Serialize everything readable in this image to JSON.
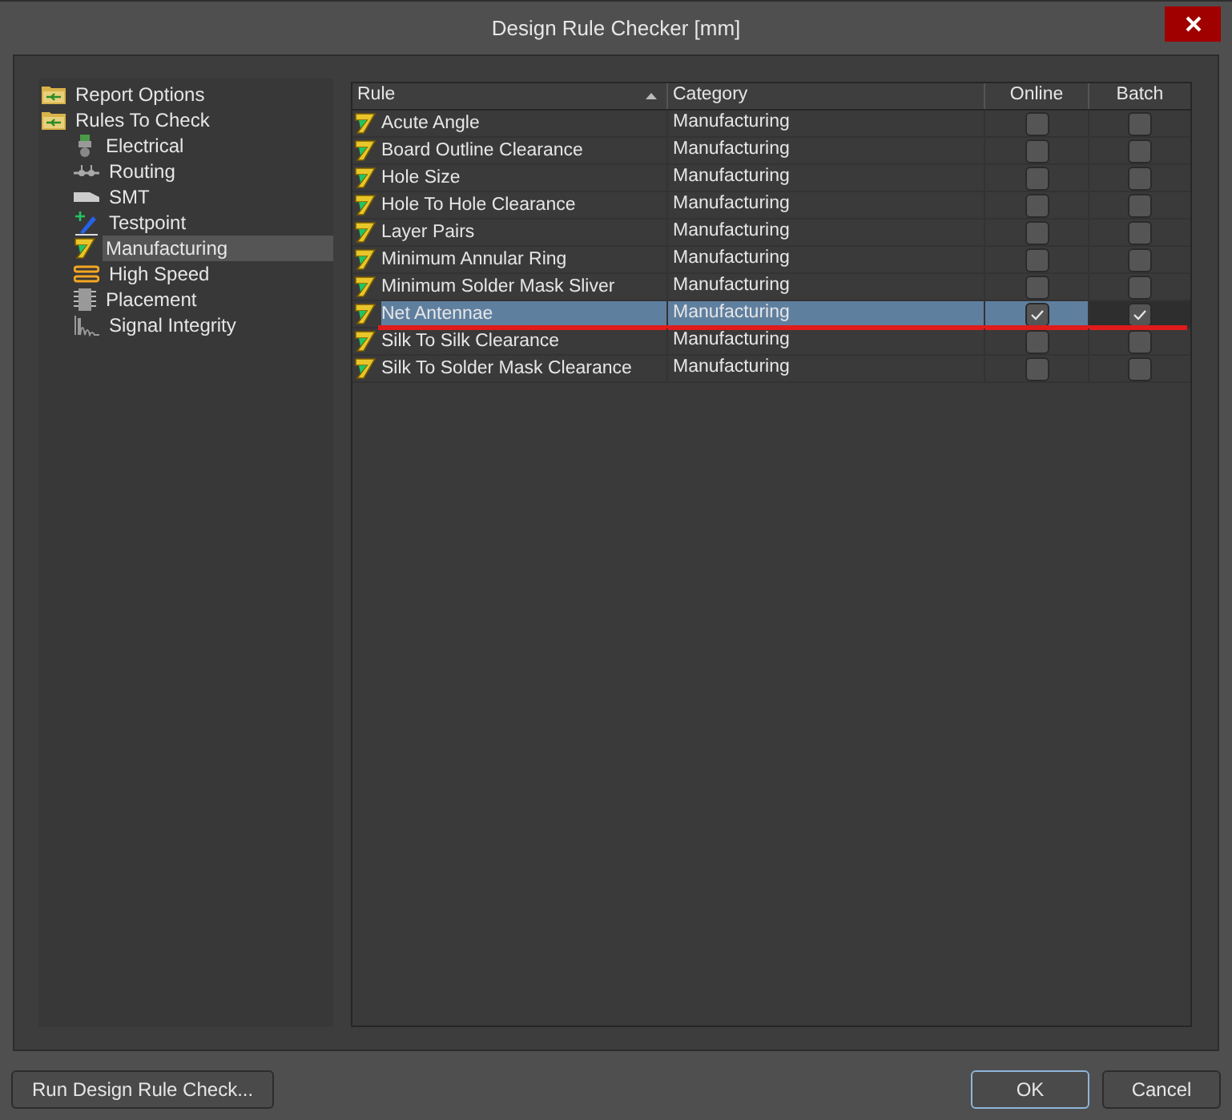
{
  "window": {
    "title": "Design Rule Checker [mm]"
  },
  "tree": [
    {
      "label": "Report Options",
      "kind": "folder",
      "selected": false
    },
    {
      "label": "Rules To Check",
      "kind": "folder",
      "selected": false,
      "children": [
        {
          "label": "Electrical",
          "kind": "electrical",
          "selected": false
        },
        {
          "label": "Routing",
          "kind": "routing",
          "selected": false
        },
        {
          "label": "SMT",
          "kind": "smt",
          "selected": false
        },
        {
          "label": "Testpoint",
          "kind": "testpoint",
          "selected": false
        },
        {
          "label": "Manufacturing",
          "kind": "rule",
          "selected": true
        },
        {
          "label": "High Speed",
          "kind": "highspeed",
          "selected": false
        },
        {
          "label": "Placement",
          "kind": "placement",
          "selected": false
        },
        {
          "label": "Signal Integrity",
          "kind": "signal",
          "selected": false
        }
      ]
    }
  ],
  "table": {
    "columns": [
      "Rule",
      "Category",
      "Online",
      "Batch"
    ],
    "rows": [
      {
        "rule": "Acute Angle",
        "category": "Manufacturing",
        "online": false,
        "batch": false,
        "selected": false
      },
      {
        "rule": "Board Outline Clearance",
        "category": "Manufacturing",
        "online": false,
        "batch": false,
        "selected": false
      },
      {
        "rule": "Hole Size",
        "category": "Manufacturing",
        "online": false,
        "batch": false,
        "selected": false
      },
      {
        "rule": "Hole To Hole Clearance",
        "category": "Manufacturing",
        "online": false,
        "batch": false,
        "selected": false
      },
      {
        "rule": "Layer Pairs",
        "category": "Manufacturing",
        "online": false,
        "batch": false,
        "selected": false
      },
      {
        "rule": "Minimum Annular Ring",
        "category": "Manufacturing",
        "online": false,
        "batch": false,
        "selected": false
      },
      {
        "rule": "Minimum Solder Mask Sliver",
        "category": "Manufacturing",
        "online": false,
        "batch": false,
        "selected": false
      },
      {
        "rule": "Net Antennae",
        "category": "Manufacturing",
        "online": true,
        "batch": true,
        "selected": true
      },
      {
        "rule": "Silk To Silk Clearance",
        "category": "Manufacturing",
        "online": false,
        "batch": false,
        "selected": false
      },
      {
        "rule": "Silk To Solder Mask Clearance",
        "category": "Manufacturing",
        "online": false,
        "batch": false,
        "selected": false
      }
    ]
  },
  "buttons": {
    "run": "Run Design Rule Check...",
    "ok": "OK",
    "cancel": "Cancel"
  }
}
